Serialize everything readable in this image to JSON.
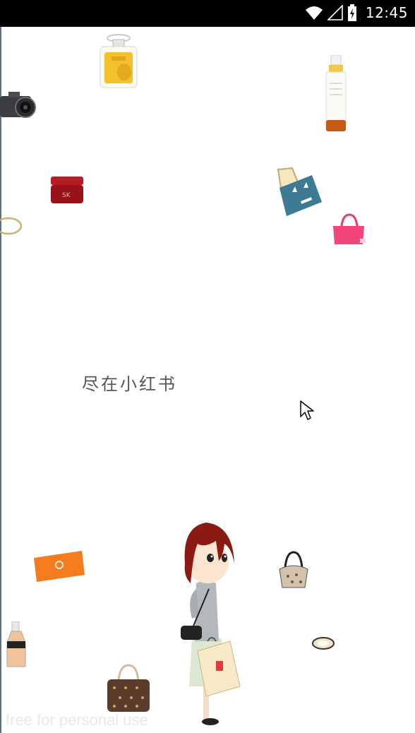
{
  "status_bar": {
    "time": "12:45",
    "icons": [
      "wifi-icon",
      "cell-signal-icon",
      "battery-icon"
    ]
  },
  "splash": {
    "slogan": "尽在小红书",
    "watermark": "free for personal use"
  },
  "illustrations": [
    "perfume-bottle",
    "camera",
    "serum-bottle",
    "cream-jar",
    "shopping-bag",
    "bracelet",
    "pink-handbag",
    "orange-clutch",
    "foundation-bottle",
    "brown-handbag",
    "shoulder-bag",
    "ring",
    "girl-with-shopping-bag"
  ],
  "colors": {
    "status_bar": "#000000",
    "background": "#ffffff",
    "slogan_text": "#555555"
  }
}
